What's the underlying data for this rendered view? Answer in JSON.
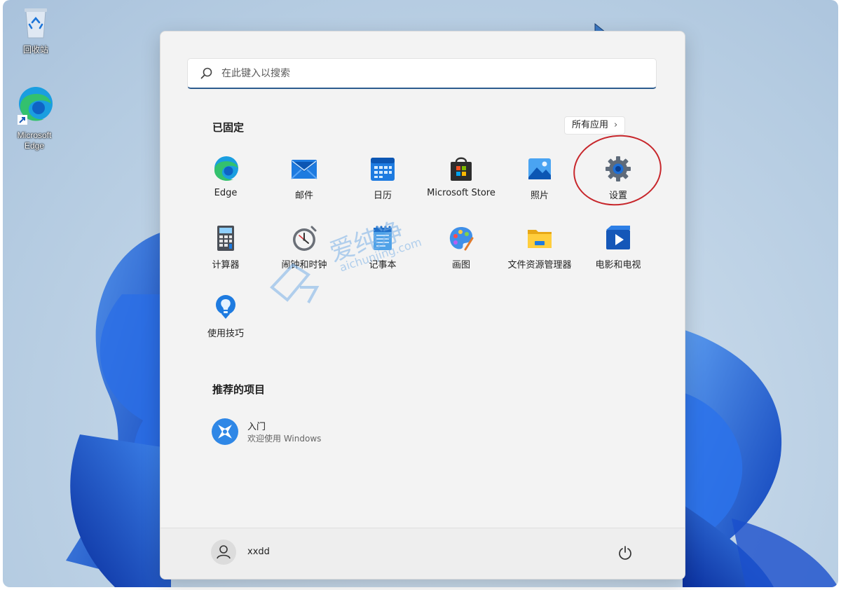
{
  "desktop": {
    "icons": [
      {
        "label": "回收站",
        "icon": "recycle-bin-icon"
      },
      {
        "label": "Microsoft Edge",
        "icon": "edge-icon"
      }
    ]
  },
  "start_menu": {
    "search": {
      "placeholder": "在此键入以搜索",
      "icon": "search-icon"
    },
    "pinned": {
      "title": "已固定",
      "all_apps_label": "所有应用",
      "apps": [
        {
          "label": "Edge",
          "icon": "edge-icon"
        },
        {
          "label": "邮件",
          "icon": "mail-icon"
        },
        {
          "label": "日历",
          "icon": "calendar-icon"
        },
        {
          "label": "Microsoft Store",
          "icon": "store-icon"
        },
        {
          "label": "照片",
          "icon": "photos-icon"
        },
        {
          "label": "设置",
          "icon": "gear-icon"
        },
        {
          "label": "计算器",
          "icon": "calculator-icon"
        },
        {
          "label": "闹钟和时钟",
          "icon": "clock-icon"
        },
        {
          "label": "记事本",
          "icon": "notepad-icon"
        },
        {
          "label": "画图",
          "icon": "paint-icon"
        },
        {
          "label": "文件资源管理器",
          "icon": "folder-icon"
        },
        {
          "label": "电影和电视",
          "icon": "movies-icon"
        },
        {
          "label": "使用技巧",
          "icon": "tips-icon"
        }
      ]
    },
    "recommended": {
      "title": "推荐的项目",
      "items": [
        {
          "title": "入门",
          "subtitle": "欢迎使用 Windows",
          "icon": "get-started-icon"
        }
      ]
    },
    "footer": {
      "user_name": "xxdd",
      "avatar_icon": "user-icon",
      "power_icon": "power-icon"
    }
  },
  "watermark": {
    "text": "爱纯净",
    "url": "aichunjing.com"
  },
  "colors": {
    "accent": "#2c5b8e",
    "highlight_ring": "#c7262b",
    "wallpaper_blue": "#1f5fd6"
  }
}
